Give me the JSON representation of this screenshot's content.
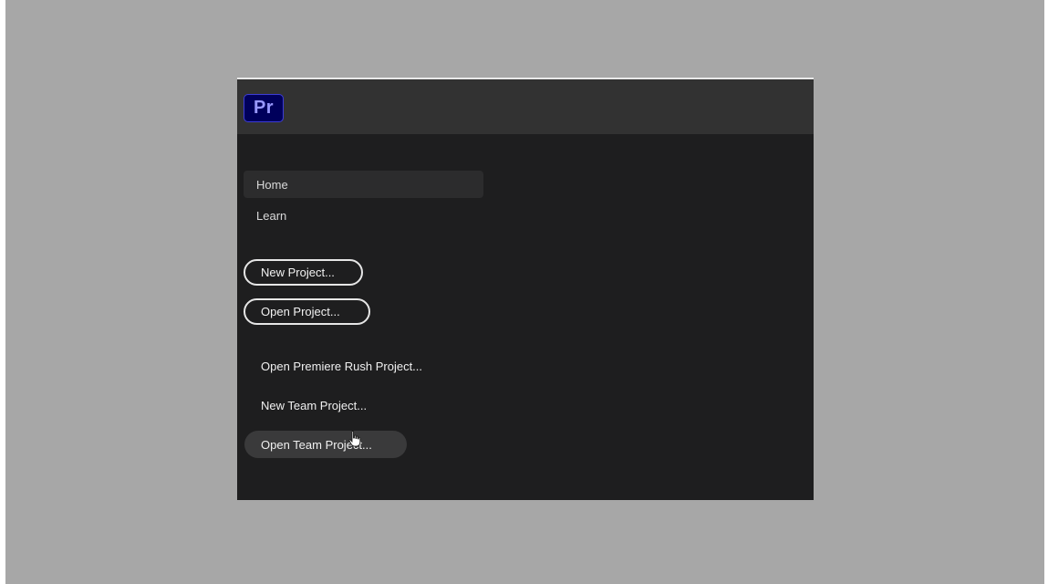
{
  "app": {
    "logo_text": "Pr",
    "logo_bg_color": "#00005b",
    "logo_text_color": "#9999ff"
  },
  "nav": {
    "items": [
      {
        "label": "Home",
        "active": true
      },
      {
        "label": "Learn",
        "active": false
      }
    ]
  },
  "buttons": {
    "new_project": "New Project...",
    "open_project": "Open Project..."
  },
  "actions": {
    "open_rush_project": "Open Premiere Rush Project...",
    "new_team_project": "New Team Project...",
    "open_team_project": "Open Team Project..."
  },
  "cursor": {
    "icon": "hand-pointer-icon"
  }
}
